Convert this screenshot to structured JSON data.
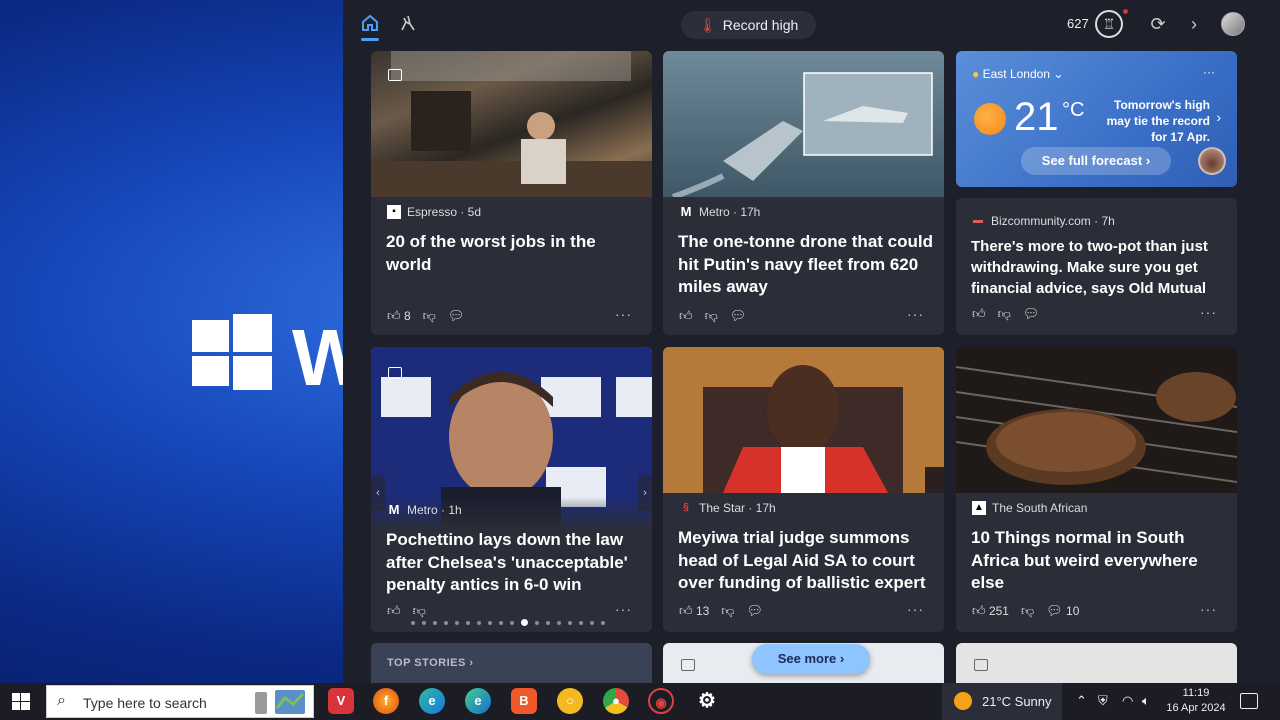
{
  "topbar": {
    "record_pill": "Record high",
    "points": "627"
  },
  "weather": {
    "location": "East London",
    "temp": "21",
    "unit": "°C",
    "note": "Tomorrow's high may tie the record for 17 Apr.",
    "button": "See full forecast"
  },
  "cards": [
    {
      "source": "Espresso · 5d",
      "headline": "20 of the worst jobs in the world",
      "likes": "8",
      "comments": ""
    },
    {
      "source": "Metro · 17h",
      "headline": "The one-tonne drone that could hit Putin's navy fleet from 620 miles away",
      "likes": "",
      "comments": ""
    },
    {
      "source": "Bizcommunity.com · 7h",
      "headline": "There's more to two-pot than just withdrawing. Make sure you get financial advice, says Old Mutual",
      "likes": "",
      "comments": ""
    },
    {
      "source": "Metro · 1h",
      "headline": "Pochettino lays down the law after Chelsea's 'unacceptable' penalty antics in 6-0 win",
      "likes": "",
      "comments": ""
    },
    {
      "source": "The Star · 17h",
      "headline": "Meyiwa trial judge summons head of Legal Aid SA to court over funding of ballistic expert",
      "likes": "13",
      "comments": ""
    },
    {
      "source": "The South African",
      "headline": "10 Things normal in South Africa but weird everywhere else",
      "likes": "251",
      "comments": "10"
    }
  ],
  "top_stories": "TOP STORIES",
  "see_more": "See more",
  "taskbar": {
    "search_placeholder": "Type here to search",
    "weather": "21°C  Sunny",
    "time": "11:19",
    "date": "16 Apr 2024"
  },
  "more_glyph": "···",
  "colors": {
    "accent": "#4f9cf7",
    "panel": "#1d1f2a",
    "card": "#2b2d38",
    "see_more": "#8ec4ff"
  }
}
